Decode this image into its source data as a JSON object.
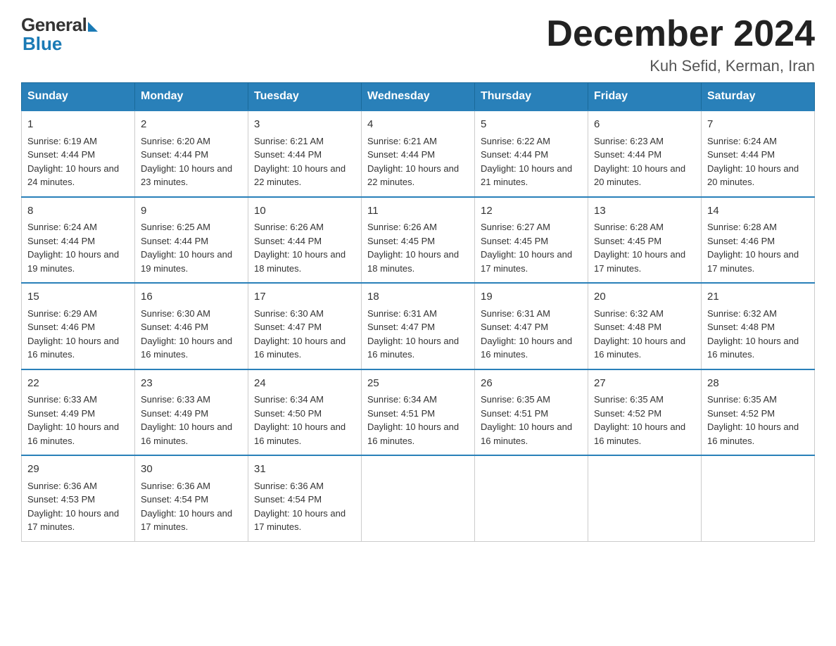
{
  "logo": {
    "general": "General",
    "blue": "Blue"
  },
  "title": "December 2024",
  "location": "Kuh Sefid, Kerman, Iran",
  "days_header": [
    "Sunday",
    "Monday",
    "Tuesday",
    "Wednesday",
    "Thursday",
    "Friday",
    "Saturday"
  ],
  "weeks": [
    [
      {
        "day": "1",
        "sunrise": "6:19 AM",
        "sunset": "4:44 PM",
        "daylight": "10 hours and 24 minutes."
      },
      {
        "day": "2",
        "sunrise": "6:20 AM",
        "sunset": "4:44 PM",
        "daylight": "10 hours and 23 minutes."
      },
      {
        "day": "3",
        "sunrise": "6:21 AM",
        "sunset": "4:44 PM",
        "daylight": "10 hours and 22 minutes."
      },
      {
        "day": "4",
        "sunrise": "6:21 AM",
        "sunset": "4:44 PM",
        "daylight": "10 hours and 22 minutes."
      },
      {
        "day": "5",
        "sunrise": "6:22 AM",
        "sunset": "4:44 PM",
        "daylight": "10 hours and 21 minutes."
      },
      {
        "day": "6",
        "sunrise": "6:23 AM",
        "sunset": "4:44 PM",
        "daylight": "10 hours and 20 minutes."
      },
      {
        "day": "7",
        "sunrise": "6:24 AM",
        "sunset": "4:44 PM",
        "daylight": "10 hours and 20 minutes."
      }
    ],
    [
      {
        "day": "8",
        "sunrise": "6:24 AM",
        "sunset": "4:44 PM",
        "daylight": "10 hours and 19 minutes."
      },
      {
        "day": "9",
        "sunrise": "6:25 AM",
        "sunset": "4:44 PM",
        "daylight": "10 hours and 19 minutes."
      },
      {
        "day": "10",
        "sunrise": "6:26 AM",
        "sunset": "4:44 PM",
        "daylight": "10 hours and 18 minutes."
      },
      {
        "day": "11",
        "sunrise": "6:26 AM",
        "sunset": "4:45 PM",
        "daylight": "10 hours and 18 minutes."
      },
      {
        "day": "12",
        "sunrise": "6:27 AM",
        "sunset": "4:45 PM",
        "daylight": "10 hours and 17 minutes."
      },
      {
        "day": "13",
        "sunrise": "6:28 AM",
        "sunset": "4:45 PM",
        "daylight": "10 hours and 17 minutes."
      },
      {
        "day": "14",
        "sunrise": "6:28 AM",
        "sunset": "4:46 PM",
        "daylight": "10 hours and 17 minutes."
      }
    ],
    [
      {
        "day": "15",
        "sunrise": "6:29 AM",
        "sunset": "4:46 PM",
        "daylight": "10 hours and 16 minutes."
      },
      {
        "day": "16",
        "sunrise": "6:30 AM",
        "sunset": "4:46 PM",
        "daylight": "10 hours and 16 minutes."
      },
      {
        "day": "17",
        "sunrise": "6:30 AM",
        "sunset": "4:47 PM",
        "daylight": "10 hours and 16 minutes."
      },
      {
        "day": "18",
        "sunrise": "6:31 AM",
        "sunset": "4:47 PM",
        "daylight": "10 hours and 16 minutes."
      },
      {
        "day": "19",
        "sunrise": "6:31 AM",
        "sunset": "4:47 PM",
        "daylight": "10 hours and 16 minutes."
      },
      {
        "day": "20",
        "sunrise": "6:32 AM",
        "sunset": "4:48 PM",
        "daylight": "10 hours and 16 minutes."
      },
      {
        "day": "21",
        "sunrise": "6:32 AM",
        "sunset": "4:48 PM",
        "daylight": "10 hours and 16 minutes."
      }
    ],
    [
      {
        "day": "22",
        "sunrise": "6:33 AM",
        "sunset": "4:49 PM",
        "daylight": "10 hours and 16 minutes."
      },
      {
        "day": "23",
        "sunrise": "6:33 AM",
        "sunset": "4:49 PM",
        "daylight": "10 hours and 16 minutes."
      },
      {
        "day": "24",
        "sunrise": "6:34 AM",
        "sunset": "4:50 PM",
        "daylight": "10 hours and 16 minutes."
      },
      {
        "day": "25",
        "sunrise": "6:34 AM",
        "sunset": "4:51 PM",
        "daylight": "10 hours and 16 minutes."
      },
      {
        "day": "26",
        "sunrise": "6:35 AM",
        "sunset": "4:51 PM",
        "daylight": "10 hours and 16 minutes."
      },
      {
        "day": "27",
        "sunrise": "6:35 AM",
        "sunset": "4:52 PM",
        "daylight": "10 hours and 16 minutes."
      },
      {
        "day": "28",
        "sunrise": "6:35 AM",
        "sunset": "4:52 PM",
        "daylight": "10 hours and 16 minutes."
      }
    ],
    [
      {
        "day": "29",
        "sunrise": "6:36 AM",
        "sunset": "4:53 PM",
        "daylight": "10 hours and 17 minutes."
      },
      {
        "day": "30",
        "sunrise": "6:36 AM",
        "sunset": "4:54 PM",
        "daylight": "10 hours and 17 minutes."
      },
      {
        "day": "31",
        "sunrise": "6:36 AM",
        "sunset": "4:54 PM",
        "daylight": "10 hours and 17 minutes."
      },
      null,
      null,
      null,
      null
    ]
  ],
  "labels": {
    "sunrise": "Sunrise:",
    "sunset": "Sunset:",
    "daylight": "Daylight:"
  }
}
